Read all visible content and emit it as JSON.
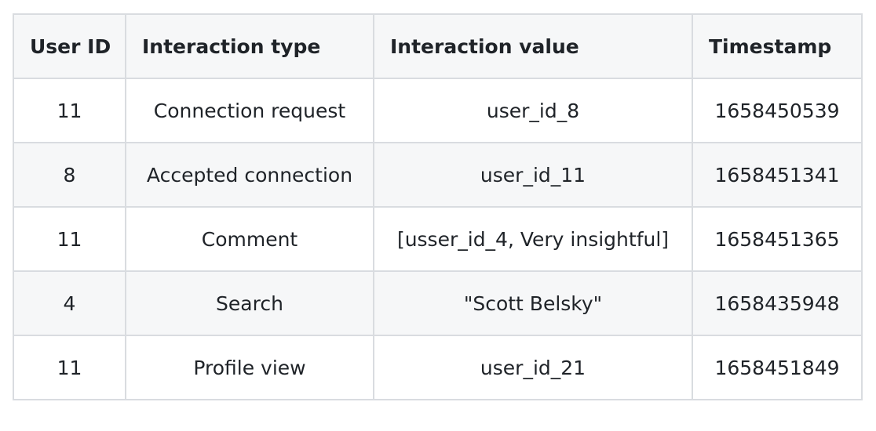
{
  "table": {
    "headers": [
      "User ID",
      "Interaction type",
      "Interaction value",
      "Timestamp"
    ],
    "rows": [
      [
        "11",
        "Connection request",
        "user_id_8",
        "1658450539"
      ],
      [
        "8",
        "Accepted connection",
        "user_id_11",
        "1658451341"
      ],
      [
        "11",
        "Comment",
        "[usser_id_4, Very insightful]",
        "1658451365"
      ],
      [
        "4",
        "Search",
        "\"Scott Belsky\"",
        "1658435948"
      ],
      [
        "11",
        "Profile view",
        "user_id_21",
        "1658451849"
      ]
    ]
  },
  "colors": {
    "border": "#d9dce0",
    "header_bg": "#f6f7f8",
    "stripe_bg": "#f6f7f8",
    "text": "#1f2328"
  }
}
